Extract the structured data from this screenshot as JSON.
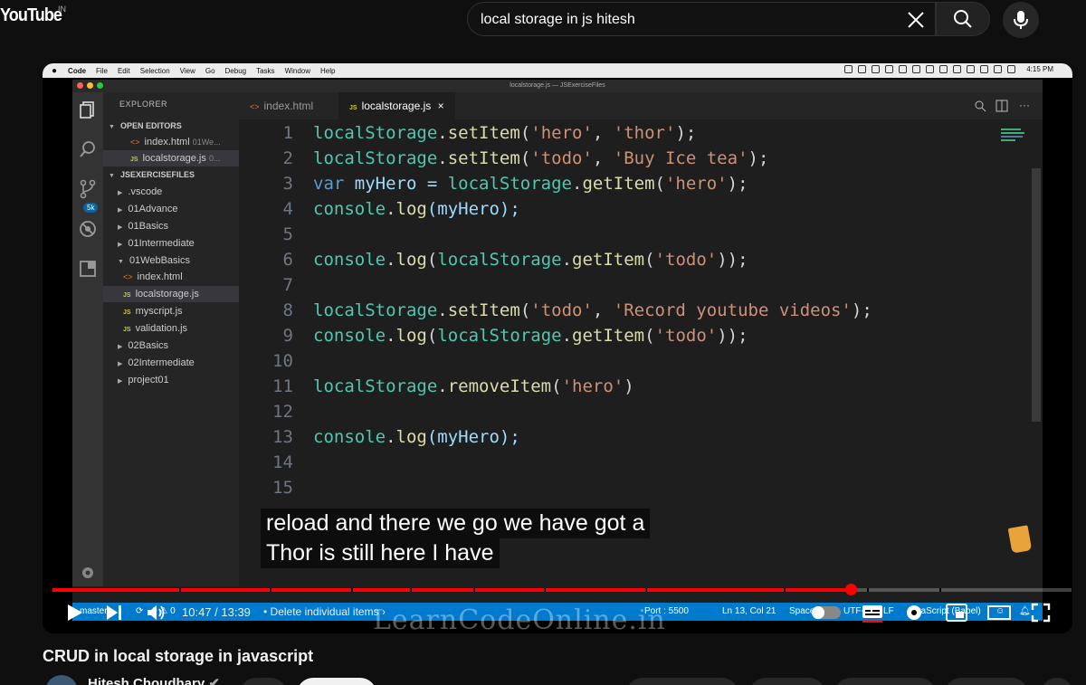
{
  "youtube": {
    "logo": "YouTube",
    "country": "IN",
    "search_value": "local storage in js hitesh"
  },
  "mac_menu": [
    "Code",
    "File",
    "Edit",
    "Selection",
    "View",
    "Go",
    "Debug",
    "Tasks",
    "Window",
    "Help"
  ],
  "mac_clock": "4:15 PM",
  "vscode": {
    "window_title": "localstorage.js — JSExerciseFiles",
    "badge": "5k",
    "explorer_title": "EXPLORER",
    "open_editors_label": "OPEN EDITORS",
    "open_editors": [
      {
        "name": "index.html",
        "hint": "01We..."
      },
      {
        "name": "localstorage.js",
        "hint": "0..."
      }
    ],
    "folder_label": "JSEXERCISEFILES",
    "tree": [
      ".vscode",
      "01Advance",
      "01Basics",
      "01Intermediate",
      "01WebBasics",
      "index.html",
      "localstorage.js",
      "myscript.js",
      "validation.js",
      "02Basics",
      "02Intermediate",
      "project01"
    ],
    "tabs": [
      "index.html",
      "localstorage.js"
    ],
    "tab_close": "×",
    "line_numbers": [
      "1",
      "2",
      "3",
      "4",
      "5",
      "6",
      "7",
      "8",
      "9",
      "10",
      "11",
      "12",
      "13",
      "14",
      "15"
    ],
    "code": [
      [
        "localStorage",
        ".",
        "setItem",
        "(",
        "'hero'",
        ", ",
        "'thor'",
        ");"
      ],
      [
        "localStorage",
        ".",
        "setItem",
        "(",
        "'todo'",
        ", ",
        "'Buy Ice tea'",
        ");"
      ],
      [
        "var",
        " myHero = ",
        "localStorage",
        ".",
        "getItem",
        "(",
        "'hero'",
        ");"
      ],
      [
        "console",
        ".",
        "log",
        "(myHero);"
      ],
      [
        "console",
        ".",
        "log",
        "(",
        "localStorage",
        ".",
        "getItem",
        "(",
        "'todo'",
        "));"
      ],
      [
        "localStorage",
        ".",
        "setItem",
        "(",
        "'todo'",
        ", ",
        "'Record youtube videos'",
        ");"
      ],
      [
        "console",
        ".",
        "log",
        "(",
        "localStorage",
        ".",
        "getItem",
        "(",
        "'todo'",
        "));"
      ],
      [
        "localStorage",
        ".",
        "removeItem",
        "(",
        "'hero'",
        ")"
      ],
      [
        "console",
        ".",
        "log",
        "(myHero);"
      ]
    ],
    "status": {
      "branch": "master*",
      "problems": "0 ⚠ 0",
      "port": "Port : 5500",
      "position": "Ln 13, Col 21",
      "spaces": "Spaces: 4",
      "encoding": "UTF-8",
      "eol": "LF",
      "language": "JavaScript (Babel)"
    }
  },
  "caption": [
    "reload and there we go we have got a",
    "Thor is still here I have"
  ],
  "watermark": "LearnCodeOnline.in",
  "player": {
    "time": "10:47 / 13:39",
    "chapter": "Delete individual items",
    "progress": 0.783
  },
  "video": {
    "title": "CRUD in local storage in javascript",
    "channel": "Hitesh Choudhary"
  }
}
